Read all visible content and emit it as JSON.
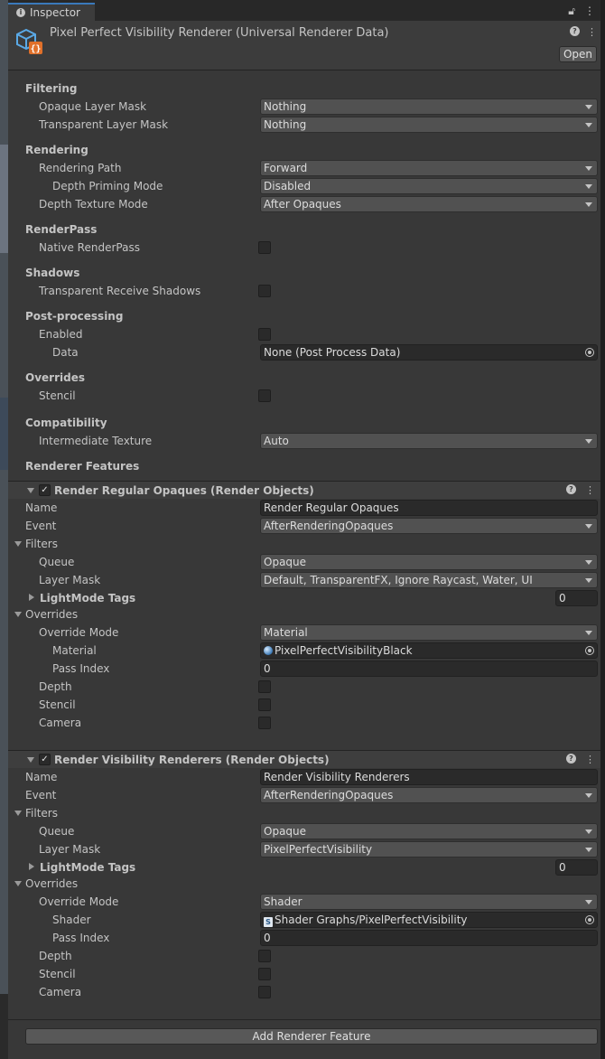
{
  "window": {
    "tab_label": "Inspector"
  },
  "asset": {
    "title": "Pixel Perfect Visibility Renderer (Universal Renderer Data)",
    "open_label": "Open"
  },
  "filtering": {
    "header": "Filtering",
    "opaque_label": "Opaque Layer Mask",
    "opaque_value": "Nothing",
    "transparent_label": "Transparent Layer Mask",
    "transparent_value": "Nothing"
  },
  "rendering": {
    "header": "Rendering",
    "path_label": "Rendering Path",
    "path_value": "Forward",
    "depth_priming_label": "Depth Priming Mode",
    "depth_priming_value": "Disabled",
    "depth_texture_label": "Depth Texture Mode",
    "depth_texture_value": "After Opaques"
  },
  "renderpass": {
    "header": "RenderPass",
    "native_label": "Native RenderPass"
  },
  "shadows": {
    "header": "Shadows",
    "transparent_receive_label": "Transparent Receive Shadows"
  },
  "postprocessing": {
    "header": "Post-processing",
    "enabled_label": "Enabled",
    "data_label": "Data",
    "data_value": "None (Post Process Data)"
  },
  "overrides": {
    "header": "Overrides",
    "stencil_label": "Stencil"
  },
  "compatibility": {
    "header": "Compatibility",
    "intermediate_label": "Intermediate Texture",
    "intermediate_value": "Auto"
  },
  "renderer_features_header": "Renderer Features",
  "features": [
    {
      "title": "Render Regular Opaques (Render Objects)",
      "name_label": "Name",
      "name_value": "Render Regular Opaques",
      "event_label": "Event",
      "event_value": "AfterRenderingOpaques",
      "filters_label": "Filters",
      "queue_label": "Queue",
      "queue_value": "Opaque",
      "layer_mask_label": "Layer Mask",
      "layer_mask_value": "Default, TransparentFX, Ignore Raycast, Water, UI",
      "lightmode_label": "LightMode Tags",
      "lightmode_count": "0",
      "overrides_label": "Overrides",
      "override_mode_label": "Override Mode",
      "override_mode_value": "Material",
      "override_object_label": "Material",
      "override_object_value": "PixelPerfectVisibilityBlack",
      "pass_index_label": "Pass Index",
      "pass_index_value": "0",
      "depth_label": "Depth",
      "stencil_label": "Stencil",
      "camera_label": "Camera"
    },
    {
      "title": "Render Visibility Renderers (Render Objects)",
      "name_label": "Name",
      "name_value": "Render Visibility Renderers",
      "event_label": "Event",
      "event_value": "AfterRenderingOpaques",
      "filters_label": "Filters",
      "queue_label": "Queue",
      "queue_value": "Opaque",
      "layer_mask_label": "Layer Mask",
      "layer_mask_value": "PixelPerfectVisibility",
      "lightmode_label": "LightMode Tags",
      "lightmode_count": "0",
      "overrides_label": "Overrides",
      "override_mode_label": "Override Mode",
      "override_mode_value": "Shader",
      "override_object_label": "Shader",
      "override_object_value": "Shader Graphs/PixelPerfectVisibility",
      "pass_index_label": "Pass Index",
      "pass_index_value": "0",
      "depth_label": "Depth",
      "stencil_label": "Stencil",
      "camera_label": "Camera"
    }
  ],
  "add_feature_label": "Add Renderer Feature",
  "colors": {
    "panel_bg": "#383838",
    "accent": "#3a79bb"
  }
}
